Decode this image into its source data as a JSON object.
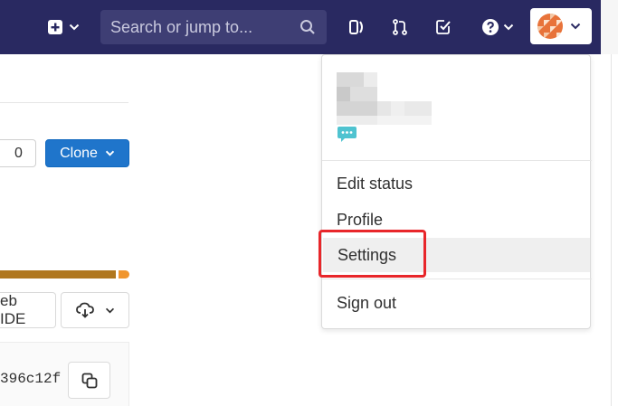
{
  "navbar": {
    "search_placeholder": "Search or jump to...",
    "icons": [
      "plus-square-icon",
      "chevron-down-icon",
      "search-icon",
      "sidebar-toggle-icon",
      "merge-request-icon",
      "todo-check-icon",
      "question-circle-icon",
      "avatar-icon"
    ],
    "colors": {
      "background": "#292961",
      "search_bg": "#3e3e74"
    }
  },
  "page": {
    "star_count": "0",
    "clone_label": "Clone",
    "web_ide_label": "eb IDE",
    "commit_sha": "396c12f"
  },
  "user_menu": {
    "items": [
      {
        "label": "Edit status"
      },
      {
        "label": "Profile"
      },
      {
        "label": "Settings"
      },
      {
        "label": "Sign out"
      }
    ],
    "highlighted_item": "Settings",
    "colors": {
      "highlight": "#e8262a",
      "hover_bg": "#efefef",
      "emoji": "#4fc3d0"
    }
  }
}
